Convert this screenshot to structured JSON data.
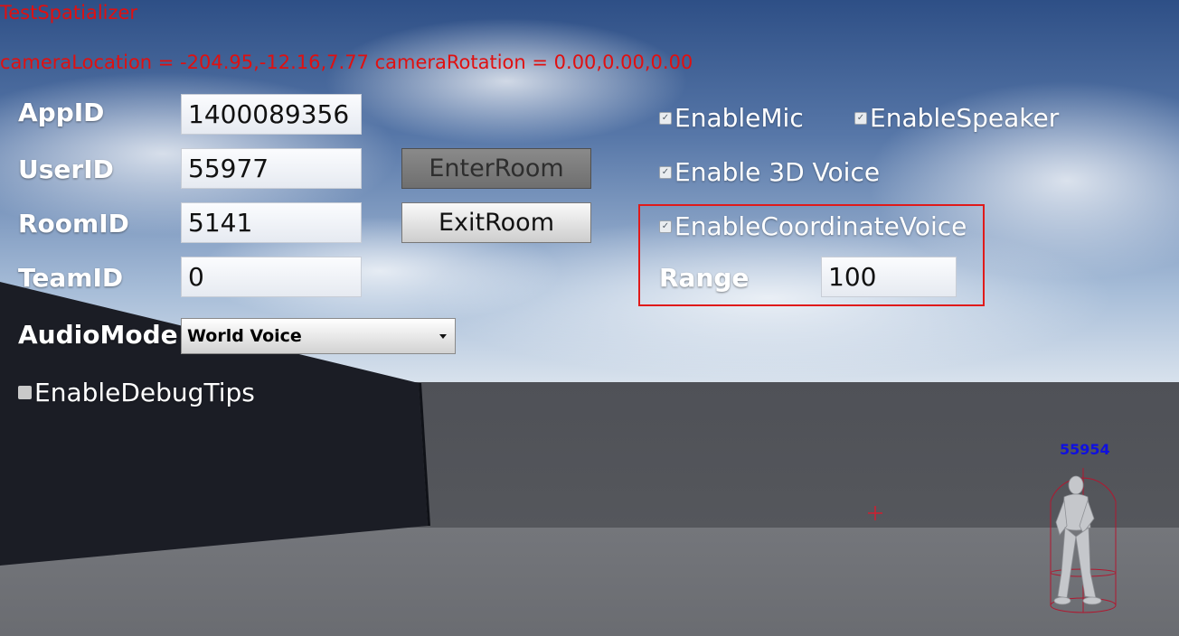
{
  "debug": {
    "title": "TestSpatializer",
    "camera_info": "cameraLocation = -204.95,-12.16,7.77 cameraRotation = 0.00,0.00,0.00"
  },
  "form": {
    "appid_label": "AppID",
    "appid_value": "1400089356",
    "userid_label": "UserID",
    "userid_value": "55977",
    "roomid_label": "RoomID",
    "roomid_value": "5141",
    "teamid_label": "TeamID",
    "teamid_value": "0",
    "audiomode_label": "AudioMode",
    "audiomode_value": "World Voice"
  },
  "buttons": {
    "enter_room": "EnterRoom",
    "exit_room": "ExitRoom"
  },
  "options": {
    "enable_mic": "EnableMic",
    "enable_speaker": "EnableSpeaker",
    "enable_3d_voice": "Enable 3D Voice",
    "enable_coordinate_voice": "EnableCoordinateVoice",
    "range_label": "Range",
    "range_value": "100",
    "enable_debug_tips": "EnableDebugTips"
  },
  "scene": {
    "player_id": "55954"
  },
  "colors": {
    "debug_text": "#e01010",
    "player_id": "#1010e0",
    "highlight_box": "#e01a1a"
  }
}
